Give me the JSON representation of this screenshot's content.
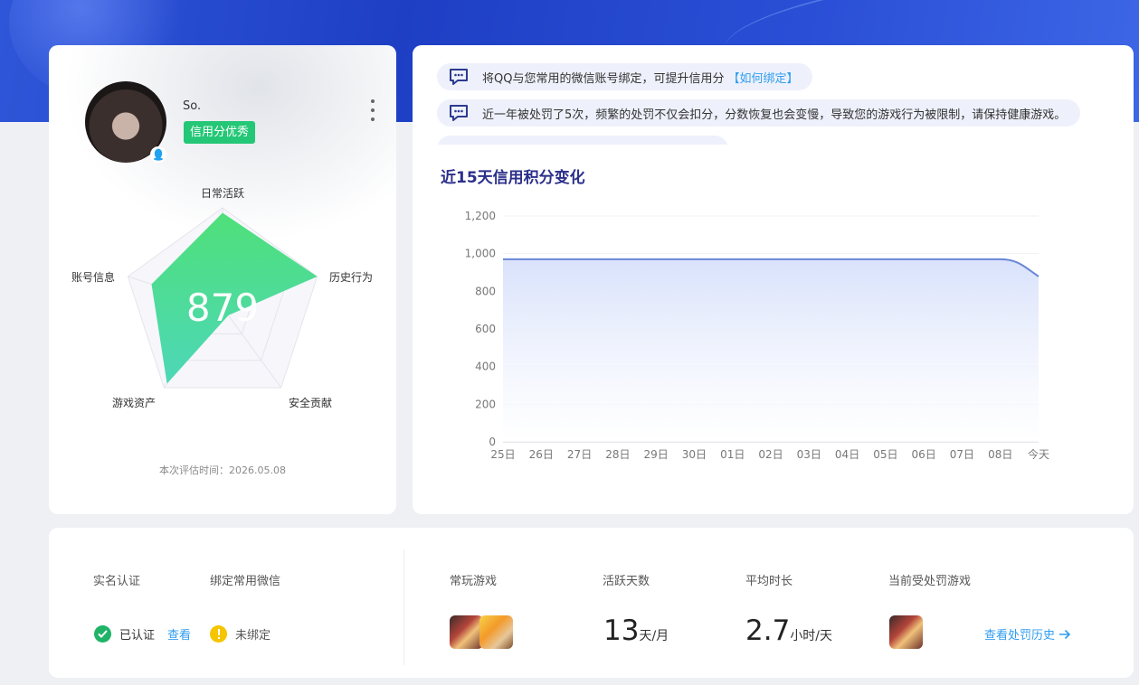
{
  "profile": {
    "username": "So.",
    "credit_badge": "信用分优秀",
    "score": "879",
    "eval_time": "本次评估时间：2026.05.08",
    "radar": {
      "labels": {
        "top": "日常活跃",
        "right": "历史行为",
        "bottom_right": "安全贡献",
        "bottom_left": "游戏资产",
        "left": "账号信息"
      },
      "values": {
        "top": 0.95,
        "right": 1.0,
        "bottom_right": 0.1,
        "bottom_left": 0.95,
        "left": 0.75
      },
      "fill_color": "#3fdc7e"
    }
  },
  "notices": [
    {
      "text": "将QQ与您常用的微信账号绑定，可提升信用分",
      "link": "【如何绑定】"
    },
    {
      "text": "近一年被处罚了5次，频繁的处罚不仅会扣分，分数恢复也会变慢，导致您的游戏行为被限制，请保持健康游戏。",
      "link": ""
    }
  ],
  "chart_section_title": "近15天信用积分变化",
  "chart_data": {
    "type": "area",
    "title": "近15天信用积分变化",
    "categories": [
      "25日",
      "26日",
      "27日",
      "28日",
      "29日",
      "30日",
      "01日",
      "02日",
      "03日",
      "04日",
      "05日",
      "06日",
      "07日",
      "08日",
      "今天"
    ],
    "series": [
      {
        "values": [
          970,
          970,
          970,
          970,
          970,
          970,
          970,
          970,
          970,
          970,
          970,
          970,
          970,
          970,
          879
        ]
      }
    ],
    "y_ticks": [
      "0",
      "200",
      "400",
      "600",
      "800",
      "1,000",
      "1,200"
    ],
    "ylim": [
      0,
      1200
    ],
    "line_color": "#6a86d8",
    "fill_color": "#dfe6fb",
    "grid": true
  },
  "stats": {
    "realname_label": "实名认证",
    "wechat_label": "绑定常用微信",
    "verified_text": "已认证",
    "view_link": "查看",
    "unbound_text": "未绑定",
    "games_label": "常玩游戏",
    "active_days_label": "活跃天数",
    "active_days_value": "13",
    "active_days_unit": "天/月",
    "avg_time_label": "平均时长",
    "avg_time_value": "2.7",
    "avg_time_unit": "小时/天",
    "punished_game_label": "当前受处罚游戏",
    "history_link": "查看处罚历史"
  },
  "colors": {
    "banner": "#2445cc",
    "badge_green": "#24c776",
    "link_blue": "#2f9df0",
    "title_navy": "#2b2f8a",
    "verified_green": "#20b368",
    "warn_yellow": "#f5c500"
  }
}
